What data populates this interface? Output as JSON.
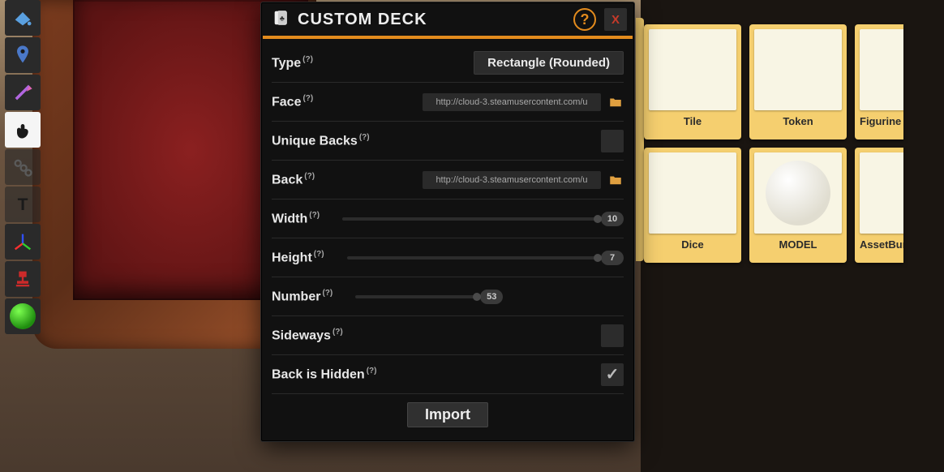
{
  "dialog": {
    "title": "CUSTOM DECK",
    "help_tooltip": "?",
    "close_label": "X",
    "rows": {
      "type": {
        "label": "Type",
        "value": "Rectangle (Rounded)"
      },
      "face": {
        "label": "Face",
        "value": "http://cloud-3.steamusercontent.com/u"
      },
      "unique_backs": {
        "label": "Unique Backs",
        "checked": false
      },
      "back": {
        "label": "Back",
        "value": "http://cloud-3.steamusercontent.com/u"
      },
      "width": {
        "label": "Width",
        "value": 10,
        "min": 1,
        "max": 10
      },
      "height": {
        "label": "Height",
        "value": 7,
        "min": 1,
        "max": 7
      },
      "number": {
        "label": "Number",
        "value": 53,
        "min": 1,
        "max": 70
      },
      "sideways": {
        "label": "Sideways",
        "checked": false
      },
      "back_hidden": {
        "label": "Back is Hidden",
        "checked": true
      }
    },
    "import_label": "Import",
    "help_marker": "(?)"
  },
  "toolbar": {
    "tools": [
      "paint-bucket-icon",
      "location-pin-icon",
      "line-tool-icon",
      "hand-grab-icon",
      "chain-joint-icon",
      "text-tool-icon",
      "gizmo-axes-icon",
      "stamp-icon",
      "color-ball"
    ],
    "active_index": 3
  },
  "library": {
    "cards": [
      {
        "label": "Tile"
      },
      {
        "label": "Token"
      },
      {
        "label": "Figurine"
      },
      {
        "label": "Dice"
      },
      {
        "label": "MODEL"
      },
      {
        "label": "AssetBundle"
      }
    ]
  }
}
